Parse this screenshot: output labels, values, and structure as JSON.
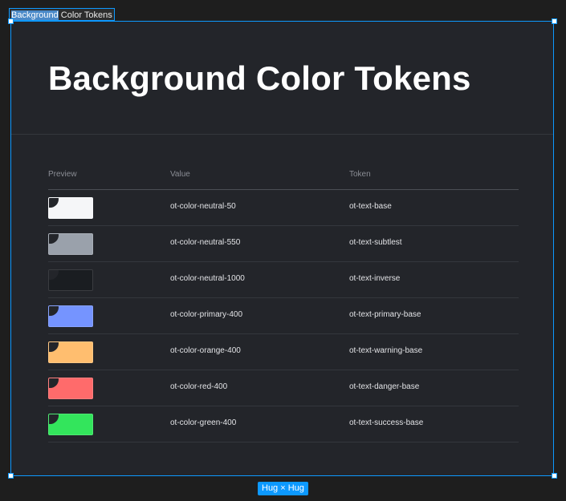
{
  "frame_label": {
    "selected_part": "Background",
    "rest": " Color Tokens"
  },
  "page_title": "Background Color Tokens",
  "table": {
    "headers": {
      "preview": "Preview",
      "value": "Value",
      "token": "Token"
    },
    "rows": [
      {
        "color": "#f5f6f8",
        "value": "ot-color-neutral-50",
        "token": "ot-text-base"
      },
      {
        "color": "#9aa1ab",
        "value": "ot-color-neutral-550",
        "token": "ot-text-subtlest"
      },
      {
        "color": "#1a1d21",
        "value": "ot-color-neutral-1000",
        "token": "ot-text-inverse"
      },
      {
        "color": "#7594ff",
        "value": "ot-color-primary-400",
        "token": "ot-text-primary-base"
      },
      {
        "color": "#ffbe6f",
        "value": "ot-color-orange-400",
        "token": "ot-text-warning-base"
      },
      {
        "color": "#ff6b6b",
        "value": "ot-color-red-400",
        "token": "ot-text-danger-base"
      },
      {
        "color": "#33e55c",
        "value": "ot-color-green-400",
        "token": "ot-text-success-base"
      }
    ]
  },
  "sizing_badge": "Hug × Hug",
  "colors": {
    "selection": "#0d99ff",
    "frame_background": "#23252a",
    "canvas_background": "#1e1e1e"
  },
  "icons": {
    "swatch_icon": "link-icon"
  }
}
